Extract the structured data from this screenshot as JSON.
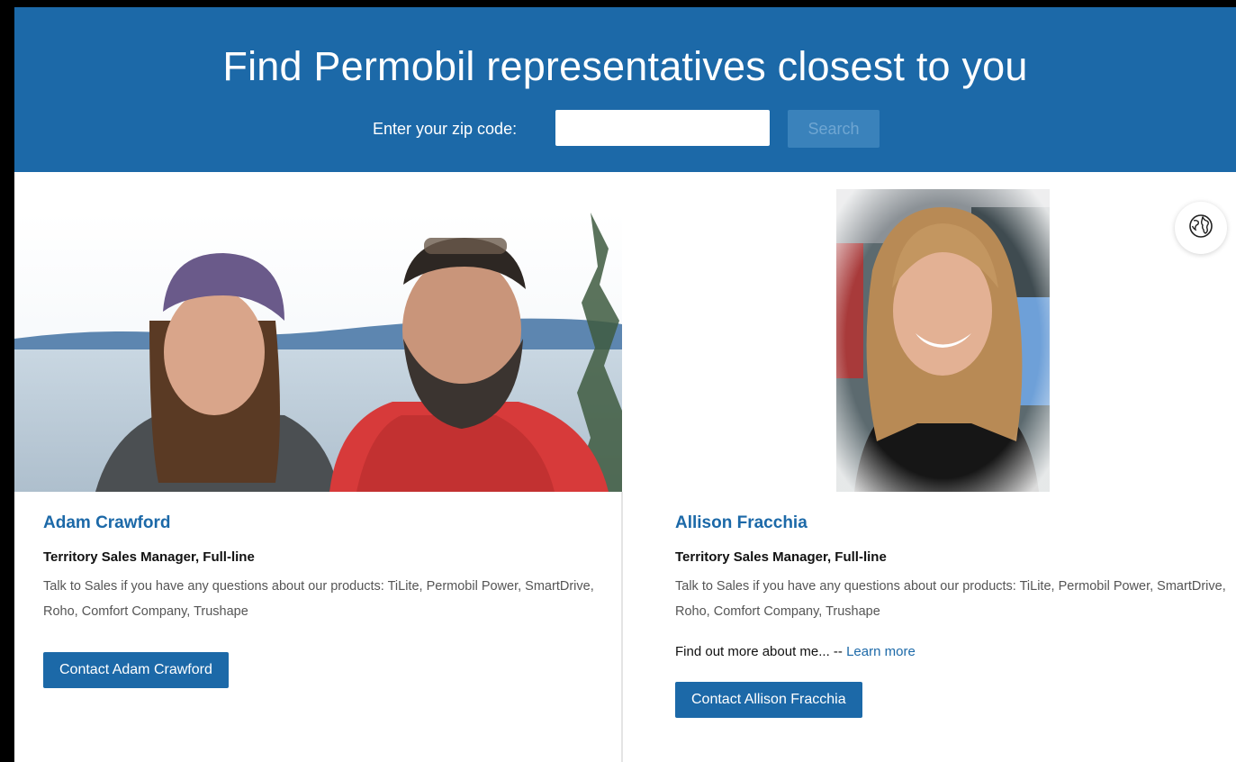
{
  "hero": {
    "title": "Find Permobil representatives closest to you",
    "zip_label": "Enter your zip code:",
    "zip_value": "",
    "zip_placeholder": "",
    "search_label": "Search"
  },
  "floating": {
    "globe_icon": "globe-icon"
  },
  "colors": {
    "brand_blue": "#1c69a8",
    "search_disabled": "#3a82bb",
    "text_dark": "#111111",
    "text_muted": "#555555"
  },
  "representatives": [
    {
      "name": "Adam Crawford",
      "title": "Territory Sales Manager, Full-line",
      "description": "Talk to Sales if you have any questions about our products: TiLite, Permobil Power, SmartDrive, Roho, Comfort Company, Trushape",
      "contact_label": "Contact Adam Crawford"
    },
    {
      "name": "Allison Fracchia",
      "title": "Territory Sales Manager, Full-line",
      "description": "Talk to Sales if you have any questions about our products: TiLite, Permobil Power, SmartDrive, Roho, Comfort Company, Trushape",
      "more_text": "Find out more about me... -- ",
      "more_link": "Learn more",
      "contact_label": "Contact Allison Fracchia"
    }
  ]
}
